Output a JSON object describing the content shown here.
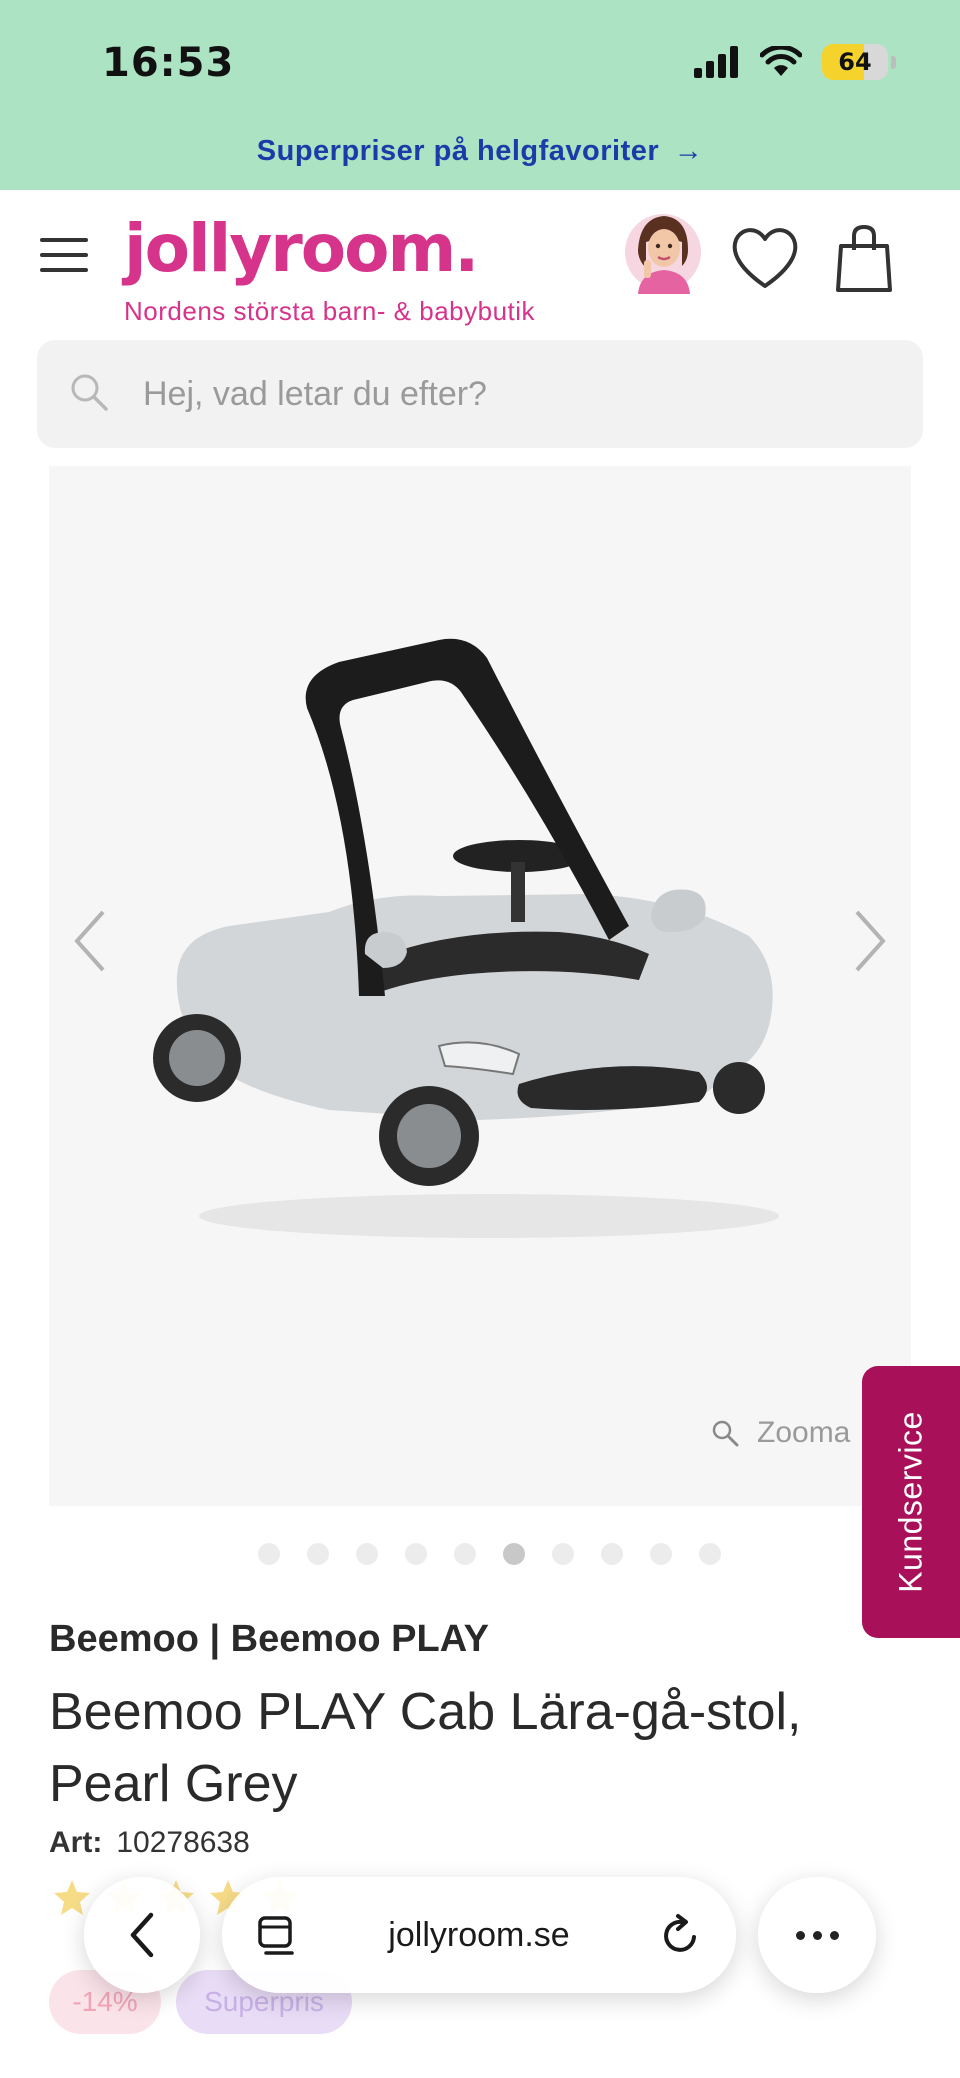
{
  "status_bar": {
    "time": "16:53",
    "battery": "64",
    "battery_level": 0.64,
    "icons": [
      "signal-icon",
      "wifi-icon",
      "battery-icon"
    ]
  },
  "promo": {
    "text": "Superpriser på helgfavoriter",
    "arrow": "→"
  },
  "header": {
    "logo": "jollyroom.",
    "tagline": "Nordens största barn- & babybutik",
    "icons": [
      "menu-icon",
      "avatar",
      "heart-icon",
      "bag-icon"
    ]
  },
  "search": {
    "placeholder": "Hej, vad letar du efter?",
    "value": ""
  },
  "gallery": {
    "zoom_label": "Zooma",
    "image_count": 10,
    "active_index": 5,
    "image_alt": "Beemoo PLAY Cab Lära-gå-stol, Pearl Grey"
  },
  "kundservice": "Kundservice",
  "product": {
    "brand": "Beemoo | Beemoo PLAY",
    "title": "Beemoo PLAY Cab Lära-gå-stol, Pearl Grey",
    "art_label": "Art:",
    "art_number": "10278638",
    "rating_stars": 5,
    "badges": {
      "discount": "-14%",
      "superpris": "Superpris"
    }
  },
  "browser": {
    "url": "jollyroom.se"
  },
  "colors": {
    "brand_pink": "#d6338a",
    "promo_bg": "#abe3c3",
    "promo_text": "#1a3ca8",
    "kundservice_bg": "#a8105a"
  }
}
